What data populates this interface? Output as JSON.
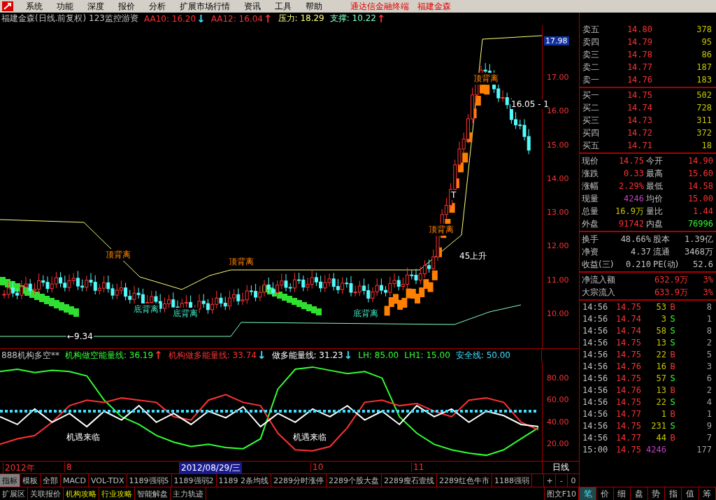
{
  "menu": {
    "items": [
      "系统",
      "功能",
      "深度",
      "报价",
      "分析",
      "扩展市场行情",
      "资讯",
      "工具",
      "帮助"
    ],
    "caption": "通达信金融终端　福建金森"
  },
  "header": [
    {
      "text": "福建金森(日线.前复权) 123监控游资",
      "color": "#c0c0c0"
    },
    {
      "text": "AA10: 16.20",
      "color": "#ff3232",
      "arrow": {
        "glyph": "↓",
        "color": "#40e0ff"
      }
    },
    {
      "text": "AA12: 16.04",
      "color": "#ff3232",
      "arrow": {
        "glyph": "↑",
        "color": "#ff3232"
      }
    },
    {
      "text": "压力: 18.29",
      "color": "#ffff80"
    },
    {
      "text": "支撑: 10.22",
      "color": "#80ffc0",
      "arrow": {
        "glyph": "↑",
        "color": "#ff3232"
      }
    }
  ],
  "price_axis": [
    "17.00",
    "16.00",
    "15.00",
    "14.00",
    "13.00",
    "12.00",
    "11.00",
    "10.00"
  ],
  "price_tag": "17.98",
  "annotations": [
    {
      "text": "顶背离",
      "kind": "top"
    },
    {
      "text": "顶背离",
      "kind": "top"
    },
    {
      "text": "顶背离",
      "kind": "top"
    },
    {
      "text": "顶背离",
      "kind": "top"
    },
    {
      "text": "底背离",
      "kind": "bottom"
    },
    {
      "text": "底背离",
      "kind": "bottom"
    },
    {
      "text": "底背离",
      "kind": "bottom"
    },
    {
      "text": "45上升",
      "kind": "plain"
    },
    {
      "text": "←9.34",
      "kind": "plain"
    },
    {
      "text": "T",
      "kind": "plain"
    },
    {
      "text": "16.05 - 1",
      "kind": "plain"
    }
  ],
  "indicator": {
    "items": [
      {
        "text": "888机构多空**",
        "color": "#c0c0c0"
      },
      {
        "text": "机构做空能量线: 36.19",
        "color": "#32ff32",
        "arrow": {
          "glyph": "↑",
          "color": "#ff3232"
        }
      },
      {
        "text": "机构做多能量线: 33.74",
        "color": "#ff3232",
        "arrow": {
          "glyph": "↓",
          "color": "#40e0ff"
        }
      },
      {
        "text": "做多能量线: 31.23",
        "color": "#ffffff",
        "arrow": {
          "glyph": "↓",
          "color": "#40e0ff"
        }
      },
      {
        "text": "LH: 85.00",
        "color": "#32ff32"
      },
      {
        "text": "LH1: 15.00",
        "color": "#32ff32"
      },
      {
        "text": "安全线: 50.00",
        "color": "#40e0ff"
      }
    ],
    "chart_data": {
      "type": "line",
      "ylim": [
        5,
        95
      ],
      "yticks": [
        {
          "value": 80,
          "label": "80.00"
        },
        {
          "value": 60,
          "label": "60.00"
        },
        {
          "value": 40,
          "label": "40.00"
        },
        {
          "value": 20,
          "label": "20.00"
        }
      ],
      "series": [
        {
          "color": "#32ff32",
          "values": [
            86,
            88,
            85,
            87,
            86,
            82,
            60,
            45,
            38,
            28,
            22,
            18,
            20,
            17,
            16,
            25,
            70,
            88,
            90,
            87,
            84,
            86,
            80,
            45,
            30,
            20,
            15,
            12,
            10,
            15,
            25,
            35
          ]
        },
        {
          "color": "#ff3232",
          "values": [
            20,
            25,
            28,
            40,
            55,
            60,
            58,
            62,
            60,
            58,
            45,
            42,
            60,
            65,
            58,
            55,
            30,
            15,
            14,
            18,
            35,
            58,
            60,
            55,
            57,
            50,
            45,
            60,
            62,
            58,
            40,
            33
          ]
        },
        {
          "color": "#ffffff",
          "values": [
            45,
            38,
            52,
            40,
            48,
            36,
            50,
            42,
            55,
            40,
            48,
            38,
            50,
            44,
            54,
            36,
            48,
            40,
            52,
            45,
            55,
            42,
            50,
            38,
            55,
            45,
            52,
            40,
            50,
            46,
            38,
            36
          ]
        },
        {
          "color": "#40e0ff",
          "line_style": "dashed",
          "values": [
            50,
            50,
            50,
            50,
            50,
            50,
            50,
            50,
            50,
            50,
            50,
            50,
            50,
            50,
            50,
            50,
            50,
            50,
            50,
            50,
            50,
            50,
            50,
            50,
            50,
            50,
            50,
            50,
            50,
            50,
            50,
            50
          ]
        }
      ]
    },
    "annotations": [
      "机遇来临",
      "机遇来临"
    ]
  },
  "dates": [
    {
      "text": "2012年",
      "selected": false
    },
    {
      "text": "8",
      "selected": false
    },
    {
      "text": "2012/08/29/三",
      "selected": true
    },
    {
      "text": "10",
      "selected": false
    },
    {
      "text": "11",
      "selected": false
    }
  ],
  "period": "日线",
  "tabs": [
    {
      "label": "指标",
      "selected": true
    },
    {
      "label": "模板",
      "selected": false
    },
    {
      "label": "全部",
      "selected": false
    },
    {
      "label": "MACD",
      "selected": false
    },
    {
      "label": "VOL-TDX",
      "selected": false
    },
    {
      "label": "1189强弱5",
      "selected": false
    },
    {
      "label": "1189强弱2",
      "selected": false
    },
    {
      "label": "1189 2条均线",
      "selected": false
    },
    {
      "label": "2289分时涨停",
      "selected": false
    },
    {
      "label": "2289个股大盘",
      "selected": false
    },
    {
      "label": "2289瘦石壹线",
      "selected": false
    },
    {
      "label": "2289红色牛市",
      "selected": false
    },
    {
      "label": "1188强弱",
      "selected": false
    }
  ],
  "zoom_buttons": [
    "+",
    "-",
    "0"
  ],
  "bottom_tabs": [
    {
      "label": "扩展区",
      "highlight": false
    },
    {
      "label": "关联报价",
      "highlight": false
    },
    {
      "label": "机构攻略",
      "highlight": true
    },
    {
      "label": "行业攻略",
      "highlight": true
    },
    {
      "label": "智能解盘",
      "highlight": false
    },
    {
      "label": "主力轨迹",
      "highlight": false
    }
  ],
  "f10_button": "图文F10",
  "sell": [
    {
      "label": "卖五",
      "price": "14.80",
      "volume": "378"
    },
    {
      "label": "卖四",
      "price": "14.79",
      "volume": "95"
    },
    {
      "label": "卖三",
      "price": "14.78",
      "volume": "86"
    },
    {
      "label": "卖二",
      "price": "14.77",
      "volume": "187"
    },
    {
      "label": "卖一",
      "price": "14.76",
      "volume": "183"
    }
  ],
  "buy": [
    {
      "label": "买一",
      "price": "14.75",
      "volume": "502"
    },
    {
      "label": "买二",
      "price": "14.74",
      "volume": "728"
    },
    {
      "label": "买三",
      "price": "14.73",
      "volume": "311"
    },
    {
      "label": "买四",
      "price": "14.72",
      "volume": "372"
    },
    {
      "label": "买五",
      "price": "14.71",
      "volume": "18"
    }
  ],
  "stats": [
    {
      "label": "现价",
      "value": "14.75",
      "color": "#ff3232"
    },
    {
      "label": "今开",
      "value": "14.90",
      "color": "#ff3232"
    },
    {
      "label": "涨跌",
      "value": "0.33",
      "color": "#ff3232"
    },
    {
      "label": "最高",
      "value": "15.60",
      "color": "#ff3232"
    },
    {
      "label": "涨幅",
      "value": "2.29%",
      "color": "#ff3232"
    },
    {
      "label": "最低",
      "value": "14.58",
      "color": "#ff3232"
    },
    {
      "label": "现量",
      "value": "4246",
      "color": "#c040c0"
    },
    {
      "label": "均价",
      "value": "15.00",
      "color": "#ff3232"
    },
    {
      "label": "总量",
      "value": "16.9万",
      "color": "#c8c800"
    },
    {
      "label": "量比",
      "value": "1.44",
      "color": "#ff3232"
    },
    {
      "label": "外盘",
      "value": "91742",
      "color": "#ff3232"
    },
    {
      "label": "内盘",
      "value": "76996",
      "color": "#32ff32"
    }
  ],
  "finance": [
    {
      "label": "换手",
      "value": "48.66%"
    },
    {
      "label": "股本",
      "value": "1.39亿"
    },
    {
      "label": "净资",
      "value": "4.37"
    },
    {
      "label": "流通",
      "value": "3468万"
    },
    {
      "label": "收益(三)",
      "value": "0.210"
    },
    {
      "label": "PE(动)",
      "value": "52.6"
    }
  ],
  "flows": [
    {
      "label": "净流入额",
      "value": "632.9万",
      "percent": "3%"
    },
    {
      "label": "大宗流入",
      "value": "633.9万",
      "percent": "3%"
    }
  ],
  "ticks": [
    {
      "time": "14:56",
      "price": "14.75",
      "volume": "53",
      "side": "B",
      "count": "8"
    },
    {
      "time": "14:56",
      "price": "14.74",
      "volume": "3",
      "side": "S",
      "count": "1"
    },
    {
      "time": "14:56",
      "price": "14.74",
      "volume": "58",
      "side": "S",
      "count": "8"
    },
    {
      "time": "14:56",
      "price": "14.75",
      "volume": "13",
      "side": "S",
      "count": "2"
    },
    {
      "time": "14:56",
      "price": "14.75",
      "volume": "22",
      "side": "B",
      "count": "5"
    },
    {
      "time": "14:56",
      "price": "14.76",
      "volume": "16",
      "side": "B",
      "count": "3"
    },
    {
      "time": "14:56",
      "price": "14.75",
      "volume": "57",
      "side": "S",
      "count": "6"
    },
    {
      "time": "14:56",
      "price": "14.76",
      "volume": "13",
      "side": "B",
      "count": "2"
    },
    {
      "time": "14:56",
      "price": "14.75",
      "volume": "22",
      "side": "S",
      "count": "4"
    },
    {
      "time": "14:56",
      "price": "14.77",
      "volume": "1",
      "side": "B",
      "count": "1"
    },
    {
      "time": "14:56",
      "price": "14.75",
      "volume": "231",
      "side": "S",
      "count": "9"
    },
    {
      "time": "14:56",
      "price": "14.77",
      "volume": "44",
      "side": "B",
      "count": "7"
    },
    {
      "time": "15:00",
      "price": "14.75",
      "volume": "4246",
      "count": "177",
      "kind": "total"
    }
  ],
  "side_tabs": [
    {
      "label": "笔",
      "selected": true
    },
    {
      "label": "价",
      "selected": false
    },
    {
      "label": "细",
      "selected": false
    },
    {
      "label": "盘",
      "selected": false
    },
    {
      "label": "势",
      "selected": false
    },
    {
      "label": "指",
      "selected": false
    },
    {
      "label": "值",
      "selected": false
    },
    {
      "label": "筹",
      "selected": false
    }
  ]
}
